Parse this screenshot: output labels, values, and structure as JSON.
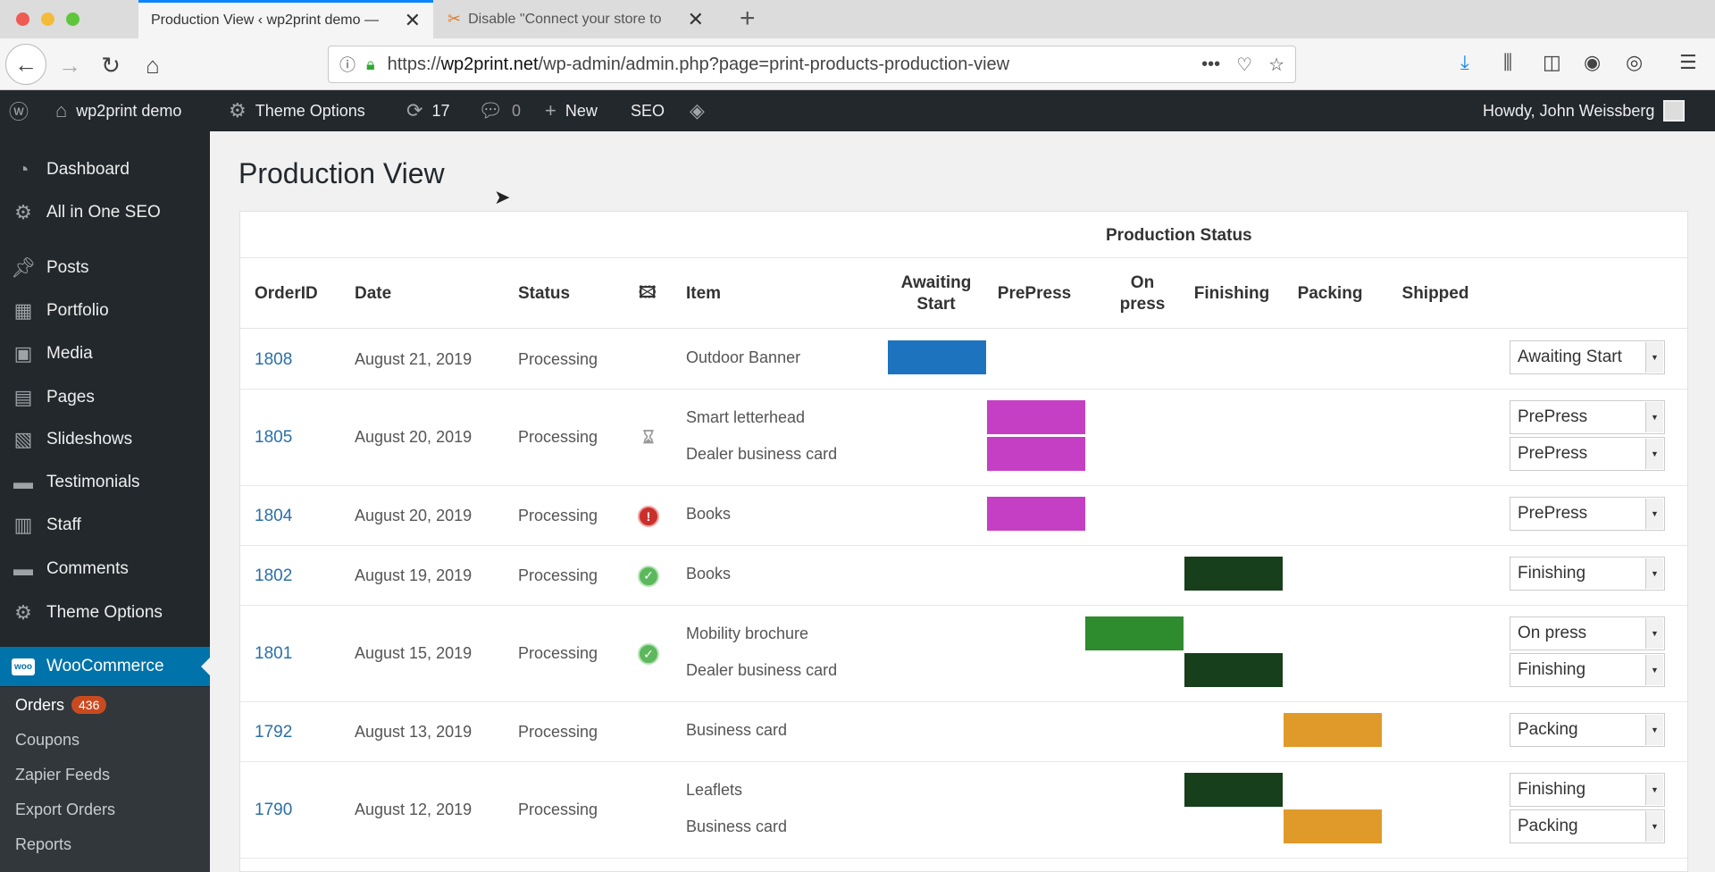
{
  "browser": {
    "tabs": [
      {
        "title": "Production View ‹ wp2print demo —",
        "active": true
      },
      {
        "title": "Disable \"Connect your store to",
        "active": false
      }
    ],
    "url_prefix": "https://",
    "url_domain": "wp2print.net",
    "url_path": "/wp-admin/admin.php?page=print-products-production-view"
  },
  "adminbar": {
    "site_name": "wp2print demo",
    "theme_options": "Theme Options",
    "updates_count": "17",
    "comments_count": "0",
    "new_label": "New",
    "seo_label": "SEO",
    "howdy": "Howdy, John Weissberg"
  },
  "sidebar": {
    "items": [
      {
        "label": "Dashboard",
        "icon": "dashboard-icon"
      },
      {
        "label": "All in One SEO",
        "icon": "gear-icon"
      },
      {
        "label": "Posts",
        "icon": "pin-icon"
      },
      {
        "label": "Portfolio",
        "icon": "portfolio-icon"
      },
      {
        "label": "Media",
        "icon": "media-icon"
      },
      {
        "label": "Pages",
        "icon": "pages-icon"
      },
      {
        "label": "Slideshows",
        "icon": "slideshow-icon"
      },
      {
        "label": "Testimonials",
        "icon": "comment-icon"
      },
      {
        "label": "Staff",
        "icon": "staff-icon"
      },
      {
        "label": "Comments",
        "icon": "comment-icon"
      },
      {
        "label": "Theme Options",
        "icon": "gear-icon"
      },
      {
        "label": "WooCommerce",
        "icon": "woo-icon"
      }
    ],
    "woo_badge": "woo",
    "submenu": [
      {
        "label": "Orders",
        "badge": "436"
      },
      {
        "label": "Coupons"
      },
      {
        "label": "Zapier Feeds"
      },
      {
        "label": "Export Orders"
      },
      {
        "label": "Reports"
      }
    ]
  },
  "page": {
    "title": "Production View",
    "production_status_label": "Production Status",
    "columns": {
      "order_id": "OrderID",
      "date": "Date",
      "status": "Status",
      "item": "Item",
      "awaiting_start": "Awaiting Start",
      "prepress": "PrePress",
      "on_press": "On press",
      "finishing": "Finishing",
      "packing": "Packing",
      "shipped": "Shipped"
    },
    "stage_colors": {
      "Awaiting Start": "#1e73be",
      "PrePress": "#c43fc4",
      "On press": "#2e8b2e",
      "Finishing": "#173f1c",
      "Packing": "#e09a2a",
      "Shipped": "#777777"
    },
    "orders": [
      {
        "id": "1808",
        "date": "August 21, 2019",
        "status": "Processing",
        "icon": "",
        "items": [
          {
            "name": "Outdoor Banner",
            "stage": "Awaiting Start"
          }
        ]
      },
      {
        "id": "1805",
        "date": "August 20, 2019",
        "status": "Processing",
        "icon": "hourglass-icon",
        "items": [
          {
            "name": "Smart letterhead",
            "stage": "PrePress"
          },
          {
            "name": "Dealer business card",
            "stage": "PrePress"
          }
        ]
      },
      {
        "id": "1804",
        "date": "August 20, 2019",
        "status": "Processing",
        "icon": "alert-icon",
        "items": [
          {
            "name": "Books",
            "stage": "PrePress"
          }
        ]
      },
      {
        "id": "1802",
        "date": "August 19, 2019",
        "status": "Processing",
        "icon": "check-icon",
        "items": [
          {
            "name": "Books",
            "stage": "Finishing"
          }
        ]
      },
      {
        "id": "1801",
        "date": "August 15, 2019",
        "status": "Processing",
        "icon": "check-icon",
        "items": [
          {
            "name": "Mobility brochure",
            "stage": "On press"
          },
          {
            "name": "Dealer business card",
            "stage": "Finishing"
          }
        ]
      },
      {
        "id": "1792",
        "date": "August 13, 2019",
        "status": "Processing",
        "icon": "",
        "items": [
          {
            "name": "Business card",
            "stage": "Packing"
          }
        ]
      },
      {
        "id": "1790",
        "date": "August 12, 2019",
        "status": "Processing",
        "icon": "",
        "items": [
          {
            "name": "Leaflets",
            "stage": "Finishing"
          },
          {
            "name": "Business card",
            "stage": "Packing"
          }
        ]
      }
    ]
  }
}
